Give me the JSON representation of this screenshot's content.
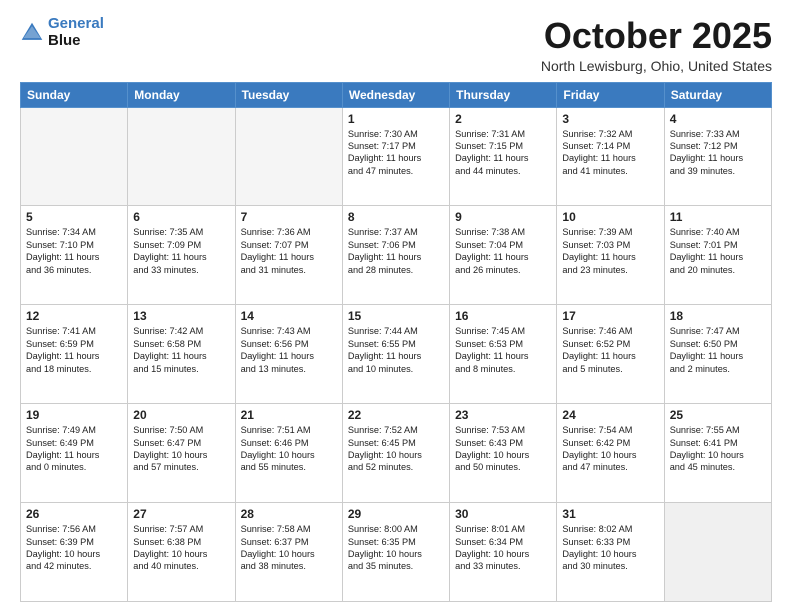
{
  "header": {
    "logo_line1": "General",
    "logo_line2": "Blue",
    "month": "October 2025",
    "location": "North Lewisburg, Ohio, United States"
  },
  "weekdays": [
    "Sunday",
    "Monday",
    "Tuesday",
    "Wednesday",
    "Thursday",
    "Friday",
    "Saturday"
  ],
  "weeks": [
    [
      {
        "day": "",
        "text": "",
        "empty": true
      },
      {
        "day": "",
        "text": "",
        "empty": true
      },
      {
        "day": "",
        "text": "",
        "empty": true
      },
      {
        "day": "1",
        "text": "Sunrise: 7:30 AM\nSunset: 7:17 PM\nDaylight: 11 hours\nand 47 minutes."
      },
      {
        "day": "2",
        "text": "Sunrise: 7:31 AM\nSunset: 7:15 PM\nDaylight: 11 hours\nand 44 minutes."
      },
      {
        "day": "3",
        "text": "Sunrise: 7:32 AM\nSunset: 7:14 PM\nDaylight: 11 hours\nand 41 minutes."
      },
      {
        "day": "4",
        "text": "Sunrise: 7:33 AM\nSunset: 7:12 PM\nDaylight: 11 hours\nand 39 minutes."
      }
    ],
    [
      {
        "day": "5",
        "text": "Sunrise: 7:34 AM\nSunset: 7:10 PM\nDaylight: 11 hours\nand 36 minutes."
      },
      {
        "day": "6",
        "text": "Sunrise: 7:35 AM\nSunset: 7:09 PM\nDaylight: 11 hours\nand 33 minutes."
      },
      {
        "day": "7",
        "text": "Sunrise: 7:36 AM\nSunset: 7:07 PM\nDaylight: 11 hours\nand 31 minutes."
      },
      {
        "day": "8",
        "text": "Sunrise: 7:37 AM\nSunset: 7:06 PM\nDaylight: 11 hours\nand 28 minutes."
      },
      {
        "day": "9",
        "text": "Sunrise: 7:38 AM\nSunset: 7:04 PM\nDaylight: 11 hours\nand 26 minutes."
      },
      {
        "day": "10",
        "text": "Sunrise: 7:39 AM\nSunset: 7:03 PM\nDaylight: 11 hours\nand 23 minutes."
      },
      {
        "day": "11",
        "text": "Sunrise: 7:40 AM\nSunset: 7:01 PM\nDaylight: 11 hours\nand 20 minutes."
      }
    ],
    [
      {
        "day": "12",
        "text": "Sunrise: 7:41 AM\nSunset: 6:59 PM\nDaylight: 11 hours\nand 18 minutes."
      },
      {
        "day": "13",
        "text": "Sunrise: 7:42 AM\nSunset: 6:58 PM\nDaylight: 11 hours\nand 15 minutes."
      },
      {
        "day": "14",
        "text": "Sunrise: 7:43 AM\nSunset: 6:56 PM\nDaylight: 11 hours\nand 13 minutes."
      },
      {
        "day": "15",
        "text": "Sunrise: 7:44 AM\nSunset: 6:55 PM\nDaylight: 11 hours\nand 10 minutes."
      },
      {
        "day": "16",
        "text": "Sunrise: 7:45 AM\nSunset: 6:53 PM\nDaylight: 11 hours\nand 8 minutes."
      },
      {
        "day": "17",
        "text": "Sunrise: 7:46 AM\nSunset: 6:52 PM\nDaylight: 11 hours\nand 5 minutes."
      },
      {
        "day": "18",
        "text": "Sunrise: 7:47 AM\nSunset: 6:50 PM\nDaylight: 11 hours\nand 2 minutes."
      }
    ],
    [
      {
        "day": "19",
        "text": "Sunrise: 7:49 AM\nSunset: 6:49 PM\nDaylight: 11 hours\nand 0 minutes."
      },
      {
        "day": "20",
        "text": "Sunrise: 7:50 AM\nSunset: 6:47 PM\nDaylight: 10 hours\nand 57 minutes."
      },
      {
        "day": "21",
        "text": "Sunrise: 7:51 AM\nSunset: 6:46 PM\nDaylight: 10 hours\nand 55 minutes."
      },
      {
        "day": "22",
        "text": "Sunrise: 7:52 AM\nSunset: 6:45 PM\nDaylight: 10 hours\nand 52 minutes."
      },
      {
        "day": "23",
        "text": "Sunrise: 7:53 AM\nSunset: 6:43 PM\nDaylight: 10 hours\nand 50 minutes."
      },
      {
        "day": "24",
        "text": "Sunrise: 7:54 AM\nSunset: 6:42 PM\nDaylight: 10 hours\nand 47 minutes."
      },
      {
        "day": "25",
        "text": "Sunrise: 7:55 AM\nSunset: 6:41 PM\nDaylight: 10 hours\nand 45 minutes."
      }
    ],
    [
      {
        "day": "26",
        "text": "Sunrise: 7:56 AM\nSunset: 6:39 PM\nDaylight: 10 hours\nand 42 minutes."
      },
      {
        "day": "27",
        "text": "Sunrise: 7:57 AM\nSunset: 6:38 PM\nDaylight: 10 hours\nand 40 minutes."
      },
      {
        "day": "28",
        "text": "Sunrise: 7:58 AM\nSunset: 6:37 PM\nDaylight: 10 hours\nand 38 minutes."
      },
      {
        "day": "29",
        "text": "Sunrise: 8:00 AM\nSunset: 6:35 PM\nDaylight: 10 hours\nand 35 minutes."
      },
      {
        "day": "30",
        "text": "Sunrise: 8:01 AM\nSunset: 6:34 PM\nDaylight: 10 hours\nand 33 minutes."
      },
      {
        "day": "31",
        "text": "Sunrise: 8:02 AM\nSunset: 6:33 PM\nDaylight: 10 hours\nand 30 minutes."
      },
      {
        "day": "",
        "text": "",
        "empty": true
      }
    ]
  ]
}
